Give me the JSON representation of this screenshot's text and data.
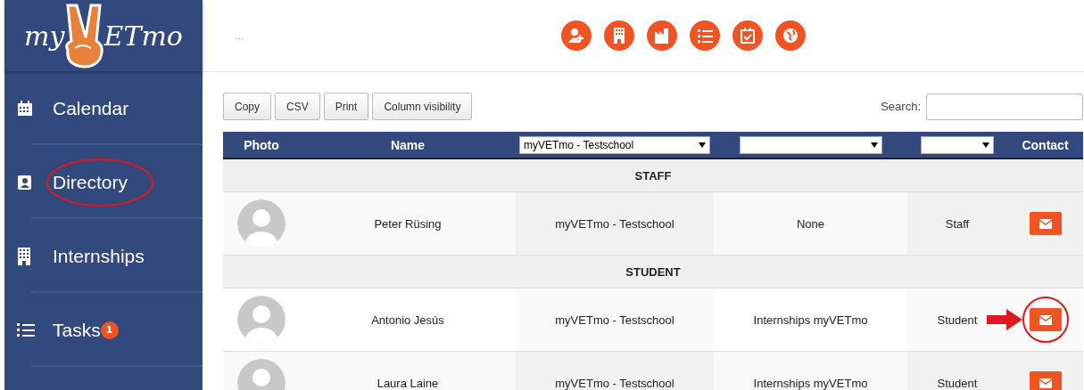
{
  "logo": {
    "left": "my",
    "right": "ETmo"
  },
  "sidebar": {
    "items": [
      {
        "label": "Calendar",
        "circled": false
      },
      {
        "label": "Directory",
        "circled": true
      },
      {
        "label": "Internships",
        "circled": false
      },
      {
        "label": "Tasks",
        "circled": false,
        "badge": "1"
      }
    ]
  },
  "topbar": {
    "menu_text": "..."
  },
  "toolbar": {
    "buttons": [
      "Copy",
      "CSV",
      "Print",
      "Column visibility"
    ],
    "search_label": "Search:"
  },
  "table": {
    "columns": [
      {
        "kind": "text",
        "label": "Photo"
      },
      {
        "kind": "text",
        "label": "Name"
      },
      {
        "kind": "select",
        "value": "myVETmo - Testschool"
      },
      {
        "kind": "select"
      },
      {
        "kind": "select"
      },
      {
        "kind": "text",
        "label": "Contact"
      }
    ],
    "groups": [
      {
        "title": "STAFF",
        "rows": [
          {
            "name": "Peter Rüsing",
            "school": "myVETmo - Testschool",
            "internship": "None",
            "role": "Staff",
            "highlighted": false
          }
        ]
      },
      {
        "title": "STUDENT",
        "rows": [
          {
            "name": "Antonio Jesús",
            "school": "myVETmo - Testschool",
            "internship": "Internships myVETmo",
            "role": "Student",
            "highlighted": true
          },
          {
            "name": "Laura Laine",
            "school": "myVETmo - Testschool",
            "internship": "Internships myVETmo",
            "role": "Student",
            "highlighted": false
          }
        ]
      }
    ]
  }
}
